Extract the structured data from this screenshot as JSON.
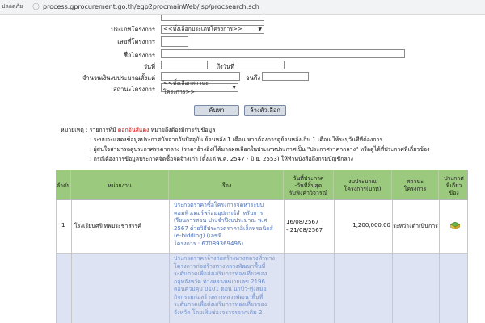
{
  "browser": {
    "warning": "ปลอดภัย",
    "url": "process.gprocurement.go.th/egp2procmainWeb/jsp/procsearch.sch"
  },
  "form": {
    "project_type_label": "ประเภทโครงการ",
    "project_type_value": "<<ทั้งเลือกประเภทโครงการ>>",
    "project_no_label": "เลขที่โครงการ",
    "project_name_label": "ชื่อโครงการ",
    "date_from_label": "วันที่",
    "date_to_label": "ถึงวันที่",
    "budget_label": "จำนวนเงินงบประมาณตั้งแต่",
    "budget_to_label": "จนถึง",
    "status_label": "สถานะโครงการ",
    "status_value": "<<ทั้งเลือกสถานะโครงการ>>",
    "search_button": "ค้นหา",
    "clear_button": "ล้างตัวเลือก"
  },
  "notes": {
    "prefix": "หมายเหตุ : รายการที่มี ",
    "highlight": "ดอกจันสีแดง",
    "suffix": " หมายถึงต้องมีการรับข้อมูล",
    "line1": ": ระบบจะแสดงข้อมูลประกาศนับจากวันปัจจุบัน ย้อนหลัง 1 เดือน หากต้องการดูย้อนหลังเกิน 1 เดือน ให้ระบุวันที่ที่ต้องการ",
    "line2": ": ผู้สนใจสามารถดูประกาศราคากลาง (ราคาอ้างอิง)ได้มากผลเลือกในประเภทประกาศเป็น \"ประกาศราคากลาง\" หรือดูได้ที่ประกาศที่เกี่ยวข้อง",
    "line3": ": กรณีต้องการข้อมูลประกาศจัดซื้อจัดจ้างเก่า (ตั้งแต่ พ.ศ. 2547 - มิ.ย. 2553) ให้ทำหนังสือถึงกรมบัญชีกลาง"
  },
  "table": {
    "headers": [
      "ลำดับ",
      "หน่วยงาน",
      "เรื่อง",
      "วันที่ประกาศ\n-วันที่สิ้นสุด\nรับฟังคำวิจารณ์",
      "งบประมาณ\nโครงการ(บาท)",
      "สถานะ\nโครงการ",
      "ประกาศ\nที่เกี่ยว\nข้อง"
    ],
    "rows": [
      {
        "index": "1",
        "agency": "โรงเรียนศรีเทพประชาสรรค์",
        "title_lines": [
          "ประกวดราคาซื้อโครงการจัดหาระบบ",
          "คอมพิวเตอร์พร้อมอุปกรณ์สำหรับการ",
          "เรียนการสอน ประจำปีงบประมาณ พ.ศ.",
          "2567 ด้วยวิธีประกวดราคาอิเล็กทรอนิกส์",
          "(e-bidding) (เลขที่",
          "โครงการ : 67089369496)"
        ],
        "dates": "16/08/2567\n- 21/08/2567",
        "budget": "1,200,000.00",
        "status": "ระหว่างดำเนินการ"
      },
      {
        "index": "",
        "agency": "",
        "title_lines": [
          "ประกวดราคาจ้างก่อสร้างทางหลวงทั่วทาง",
          "โครงการก่อสร้างทางหลวงพัฒนาพื้นที่",
          "ระดับภาคเพื่อส่งเสริมการท่องเที่ยวของ",
          "กลุ่มจังหวัด ทางหลวงหมายเลข 2196",
          "ตอนควบคุม 0101 ตอน นาบัว-ทุ่งสมอ",
          "กิจกรรมก่อสร้างทางหลวงพัฒนาพื้นที่",
          "ระดับภาคเพื่อส่งเสริมการท่องเที่ยวของ",
          "จังหวัด โดยเพิ่มช่องจราจรจากเดิม 2"
        ],
        "dates": "",
        "budget": "",
        "status": ""
      }
    ]
  }
}
